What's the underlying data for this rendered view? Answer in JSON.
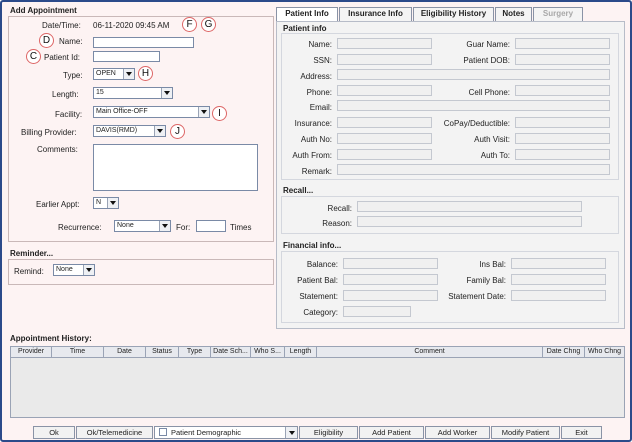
{
  "add_appointment": {
    "title": "Add Appointment",
    "datetime_label": "Date/Time:",
    "datetime_value": "06-11-2020 09:45 AM",
    "name_label": "Name:",
    "patient_id_label": "Patient Id:",
    "type_label": "Type:",
    "type_value": "OPEN",
    "length_label": "Length:",
    "length_value": "15",
    "facility_label": "Facility:",
    "facility_value": "Main Office-OFF",
    "billing_provider_label": "Billing Provider:",
    "billing_provider_value": "DAVIS(RMD)",
    "comments_label": "Comments:",
    "earlier_appt_label": "Earlier Appt:",
    "earlier_appt_value": "N",
    "recurrence_label": "Recurrence:",
    "recurrence_value": "None",
    "for_label": "For:",
    "times_label": "Times"
  },
  "reminder": {
    "title": "Reminder...",
    "remind_label": "Remind:",
    "remind_value": "None"
  },
  "callouts": [
    "D",
    "C",
    "F",
    "G",
    "H",
    "I",
    "J"
  ],
  "tabs": [
    {
      "label": "Patient Info",
      "active": true
    },
    {
      "label": "Insurance Info"
    },
    {
      "label": "Eligibility History"
    },
    {
      "label": "Notes"
    },
    {
      "label": "Surgery",
      "disabled": true
    }
  ],
  "patient_info": {
    "title": "Patient info",
    "name": "Name:",
    "guar_name": "Guar Name:",
    "ssn": "SSN:",
    "patient_dob": "Patient DOB:",
    "address": "Address:",
    "phone": "Phone:",
    "cell_phone": "Cell Phone:",
    "email": "Email:",
    "insurance": "Insurance:",
    "copay": "CoPay/Deductible:",
    "auth_no": "Auth No:",
    "auth_visit": "Auth Visit:",
    "auth_from": "Auth From:",
    "auth_to": "Auth To:",
    "remark": "Remark:"
  },
  "recall": {
    "title": "Recall...",
    "recall": "Recall:",
    "reason": "Reason:"
  },
  "financial": {
    "title": "Financial info...",
    "balance": "Balance:",
    "ins_bal": "Ins Bal:",
    "patient_bal": "Patient Bal:",
    "family_bal": "Family Bal:",
    "statement": "Statement:",
    "statement_date": "Statement Date:",
    "category": "Category:"
  },
  "history": {
    "title": "Appointment History:",
    "columns": [
      "Provider",
      "Time",
      "Date",
      "Status",
      "Type",
      "Date Sch...",
      "Who S...",
      "Length",
      "Comment",
      "Date Chng",
      "Who Chng"
    ]
  },
  "buttons": {
    "ok": "Ok",
    "ok_telemedicine": "Ok/Telemedicine",
    "patient_demographic": "Patient Demographic",
    "eligibility": "Eligibility",
    "add_patient": "Add Patient",
    "add_worker": "Add Worker",
    "modify_patient": "Modify Patient",
    "exit": "Exit"
  }
}
